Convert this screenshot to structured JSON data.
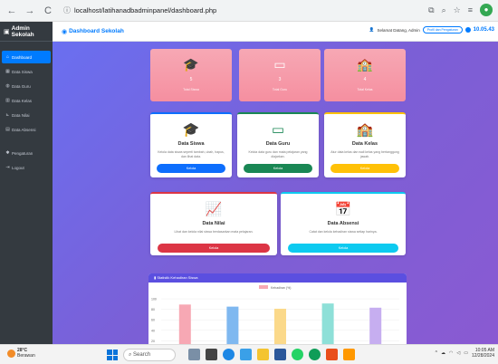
{
  "browser": {
    "back": "←",
    "forward": "→",
    "reload": "C",
    "url": "localhost/latihanadbadminpanel/dashboard.php"
  },
  "sidebar": {
    "brand": "Admin Sekolah",
    "items": [
      {
        "label": "Dashboard",
        "icon": "home-icon"
      },
      {
        "label": "Data Siswa",
        "icon": "users-icon"
      },
      {
        "label": "Data Guru",
        "icon": "teacher-icon"
      },
      {
        "label": "Data Kelas",
        "icon": "school-icon"
      },
      {
        "label": "Data Nilai",
        "icon": "chart-icon"
      },
      {
        "label": "Data Absensi",
        "icon": "calendar-icon"
      },
      {
        "label": "Pengaturan",
        "icon": "gear-icon"
      },
      {
        "label": "Logout",
        "icon": "logout-icon"
      }
    ]
  },
  "topnav": {
    "title": "Dashboard Sekolah",
    "welcome": "Selamat Datang, Admin",
    "badge": "Profil dan Pengaturan",
    "time": "10.05.43"
  },
  "stats": [
    {
      "value": "5",
      "label": "Total Siswa",
      "icon": "graduate-icon"
    },
    {
      "value": "3",
      "label": "Total Guru",
      "icon": "teacher-icon"
    },
    {
      "value": "4",
      "label": "Total Kelas",
      "icon": "school-icon"
    }
  ],
  "features": [
    {
      "title": "Data Siswa",
      "desc": "Kelola data siswa seperti tambah, ubah, hapus, dan lihat data.",
      "button": "Kelola",
      "color": "#0d6efd",
      "icon": "graduate-icon"
    },
    {
      "title": "Data Guru",
      "desc": "Kelola data guru dan mata pelajaran yang diajarkan.",
      "button": "Kelola",
      "color": "#198754",
      "icon": "teacher-icon"
    },
    {
      "title": "Data Kelas",
      "desc": "Atur data kelas dan wali kelas yang bertanggung jawab.",
      "button": "Kelola",
      "color": "#ffc107",
      "icon": "school-icon"
    },
    {
      "title": "Data Nilai",
      "desc": "Lihat dan kelola nilai siswa berdasarkan mata pelajaran.",
      "button": "Kelola",
      "color": "#dc3545",
      "icon": "chart-line-icon"
    },
    {
      "title": "Data Absensi",
      "desc": "Catat dan kelola kehadiran siswa setiap harinya.",
      "button": "Kelola",
      "color": "#0dcaf0",
      "icon": "calendar-check-icon"
    }
  ],
  "chart_section": {
    "header": "Statistik Kehadiran Siswa"
  },
  "chart_data": {
    "type": "bar",
    "title": "",
    "legend": "Kehadiran (%)",
    "legend_position": "top",
    "categories": [
      "",
      "",
      "",
      "",
      ""
    ],
    "values": [
      96,
      92,
      88,
      98,
      90
    ],
    "colors": [
      "#f7a8b4",
      "#7fb8f0",
      "#fbd98a",
      "#8ee0d8",
      "#c6aef0"
    ],
    "ylim": [
      0,
      100
    ],
    "yticks": [
      "100",
      "80",
      "60",
      "40",
      "20"
    ],
    "grid": true
  },
  "taskbar": {
    "temp": "28°C",
    "weather": "Berawan",
    "search": "Search",
    "time": "10:05 AM",
    "date": "12/28/2024"
  }
}
